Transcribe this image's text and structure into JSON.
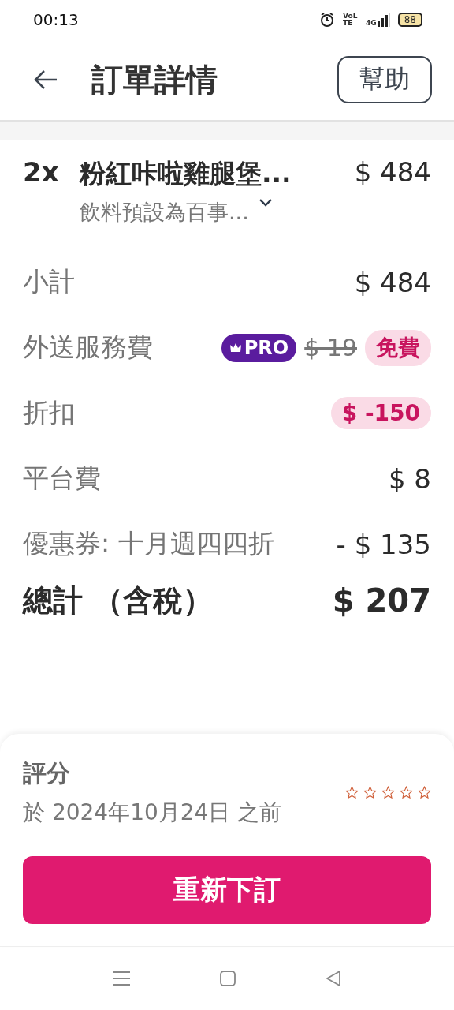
{
  "status_bar": {
    "time": "00:13",
    "volte": "VoLTE",
    "network": "4G",
    "battery": "88"
  },
  "header": {
    "title": "訂單詳情",
    "help": "幫助"
  },
  "items": [
    {
      "quantity": "2x",
      "name": "粉紅咔啦雞腿堡...",
      "price": "$ 484",
      "note": "飲料預設為百事...",
      "expanded": false
    }
  ],
  "fees": [
    {
      "kind": "plain",
      "label": "小計",
      "value": "$ 484"
    },
    {
      "kind": "pro",
      "label": "外送服務費",
      "badge": "PRO",
      "old_price": "$ 19",
      "value": "免費"
    },
    {
      "kind": "pill",
      "label": "折扣",
      "value": "$ -150"
    },
    {
      "kind": "plain",
      "label": "平台費",
      "value": "$ 8"
    },
    {
      "kind": "plain",
      "label": "優惠券: 十月週四四折",
      "value": "- $ 135"
    }
  ],
  "total": {
    "label": "總計 （含稅）",
    "value": "$ 207"
  },
  "rating": {
    "title": "評分",
    "deadline": "於 2024年10月24日 之前",
    "stars": 0
  },
  "reorder_button": "重新下訂"
}
